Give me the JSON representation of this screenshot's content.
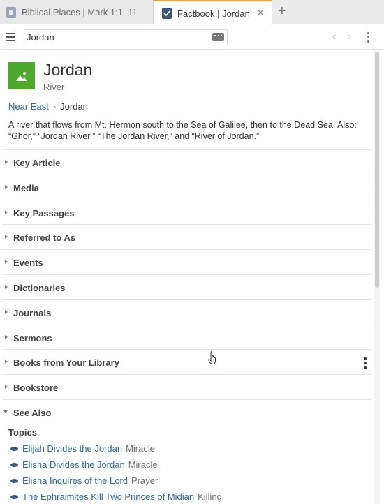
{
  "tabs": [
    {
      "label": "Biblical Places | Mark 1:1–11",
      "active": false
    },
    {
      "label": "Factbook | Jordan",
      "active": true
    }
  ],
  "tab_close_glyph": "✕",
  "add_tab_glyph": "+",
  "toolbar": {
    "search_value": "Jordan",
    "prev_glyph": "‹",
    "next_glyph": "›"
  },
  "article": {
    "title": "Jordan",
    "type": "River",
    "breadcrumb": {
      "parent": "Near East",
      "separator": "›",
      "current": "Jordan"
    },
    "description": "A river that flows from Mt. Hermon south to the Sea of Galilee, then to the Dead Sea. Also: “Ghor,” “Jordan River,” “The Jordan River,” and “River of Jordan.”"
  },
  "sections": [
    {
      "label": "Key Article"
    },
    {
      "label": "Media"
    },
    {
      "label": "Key Passages"
    },
    {
      "label": "Referred to As"
    },
    {
      "label": "Events"
    },
    {
      "label": "Dictionaries"
    },
    {
      "label": "Journals"
    },
    {
      "label": "Sermons"
    },
    {
      "label": "Books from Your Library"
    },
    {
      "label": "Bookstore"
    },
    {
      "label": "See Also"
    }
  ],
  "see_also": {
    "heading": "Topics",
    "topics": [
      {
        "title": "Elijah Divides the Jordan",
        "category": "Miracle"
      },
      {
        "title": "Elisha Divides the Jordan",
        "category": "Miracle"
      },
      {
        "title": "Elisha Inquires of the Lord",
        "category": "Prayer"
      },
      {
        "title": "The Ephraimites Kill Two Princes of Midian",
        "category": "Killing"
      }
    ]
  },
  "colors": {
    "accent_tab": "#e8a04a",
    "link": "#2a6aa6",
    "thumbnail": "#4ea82c"
  }
}
